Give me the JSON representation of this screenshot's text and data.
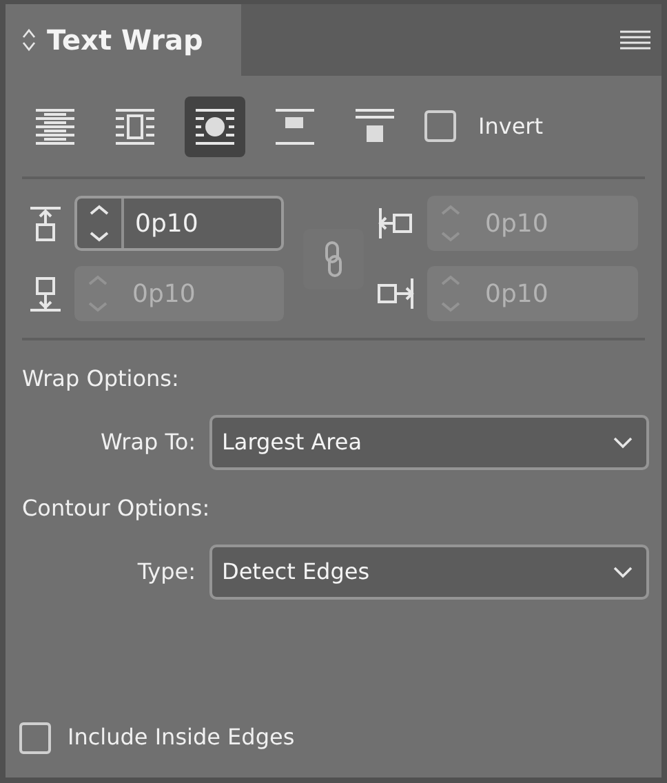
{
  "panel": {
    "tab_title": "Text Wrap"
  },
  "wrap_modes": [
    {
      "kind": "none",
      "selected": false
    },
    {
      "kind": "bounding-box",
      "selected": false
    },
    {
      "kind": "object-shape",
      "selected": true
    },
    {
      "kind": "jump-object",
      "selected": false
    },
    {
      "kind": "next-column",
      "selected": false
    }
  ],
  "invert": {
    "label": "Invert",
    "checked": false
  },
  "offsets": [
    {
      "kind": "top",
      "value": "0p10",
      "disabled": false
    },
    {
      "kind": "left",
      "value": "0p10",
      "disabled": true
    },
    {
      "kind": "bottom",
      "value": "0p10",
      "disabled": true
    },
    {
      "kind": "right",
      "value": "0p10",
      "disabled": true
    }
  ],
  "link_offsets": {
    "disabled": true
  },
  "wrap_options": {
    "heading": "Wrap Options:",
    "label": "Wrap To:",
    "value": "Largest Area"
  },
  "contour_options": {
    "heading": "Contour Options:",
    "label": "Type:",
    "value": "Detect Edges"
  },
  "include_inside_edges": {
    "label": "Include Inside Edges",
    "checked": false
  }
}
